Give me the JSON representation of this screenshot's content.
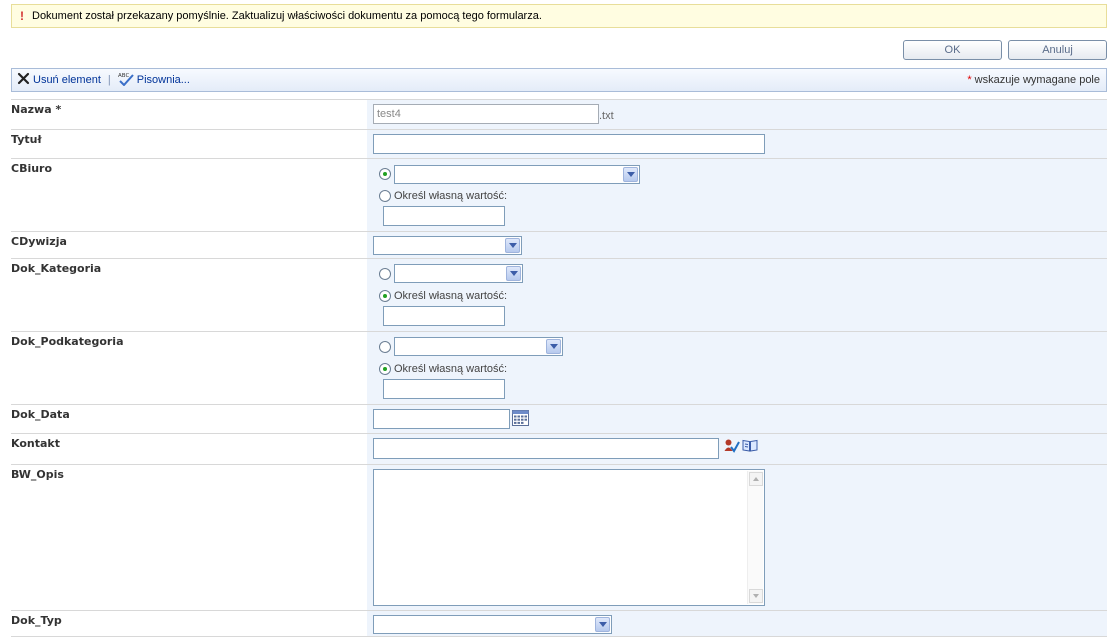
{
  "info": {
    "icon": "exclamation-icon",
    "message": "Dokument został przekazany pomyślnie. Zaktualizuj właściwości dokumentu za pomocą tego formularza."
  },
  "buttons": {
    "ok": "OK",
    "cancel": "Anuluj"
  },
  "toolbar": {
    "delete_label": "Usuń element",
    "separator": "|",
    "spelling_label": "Pisownia...",
    "required_star": "*",
    "required_note": " wskazuje wymagane pole"
  },
  "fields": {
    "nazwa": {
      "label": "Nazwa",
      "star": "*",
      "value": "test4",
      "suffix": ".txt"
    },
    "tytul": {
      "label": "Tytuł",
      "value": ""
    },
    "cbiuro": {
      "label": "CBiuro",
      "custom_label": "Określ własną wartość:"
    },
    "cdywizja": {
      "label": "CDywizja"
    },
    "dok_kategoria": {
      "label": "Dok_Kategoria",
      "custom_label": "Określ własną wartość:"
    },
    "dok_podkategoria": {
      "label": "Dok_Podkategoria",
      "custom_label": "Określ własną wartość:"
    },
    "dok_data": {
      "label": "Dok_Data"
    },
    "kontakt": {
      "label": "Kontakt"
    },
    "bw_opis": {
      "label": "BW_Opis"
    },
    "dok_typ": {
      "label": "Dok_Typ"
    }
  },
  "colors": {
    "accent": "#003399",
    "info_bg": "#fffde1",
    "field_bg": "#eef4fc",
    "required": "#e00000"
  }
}
